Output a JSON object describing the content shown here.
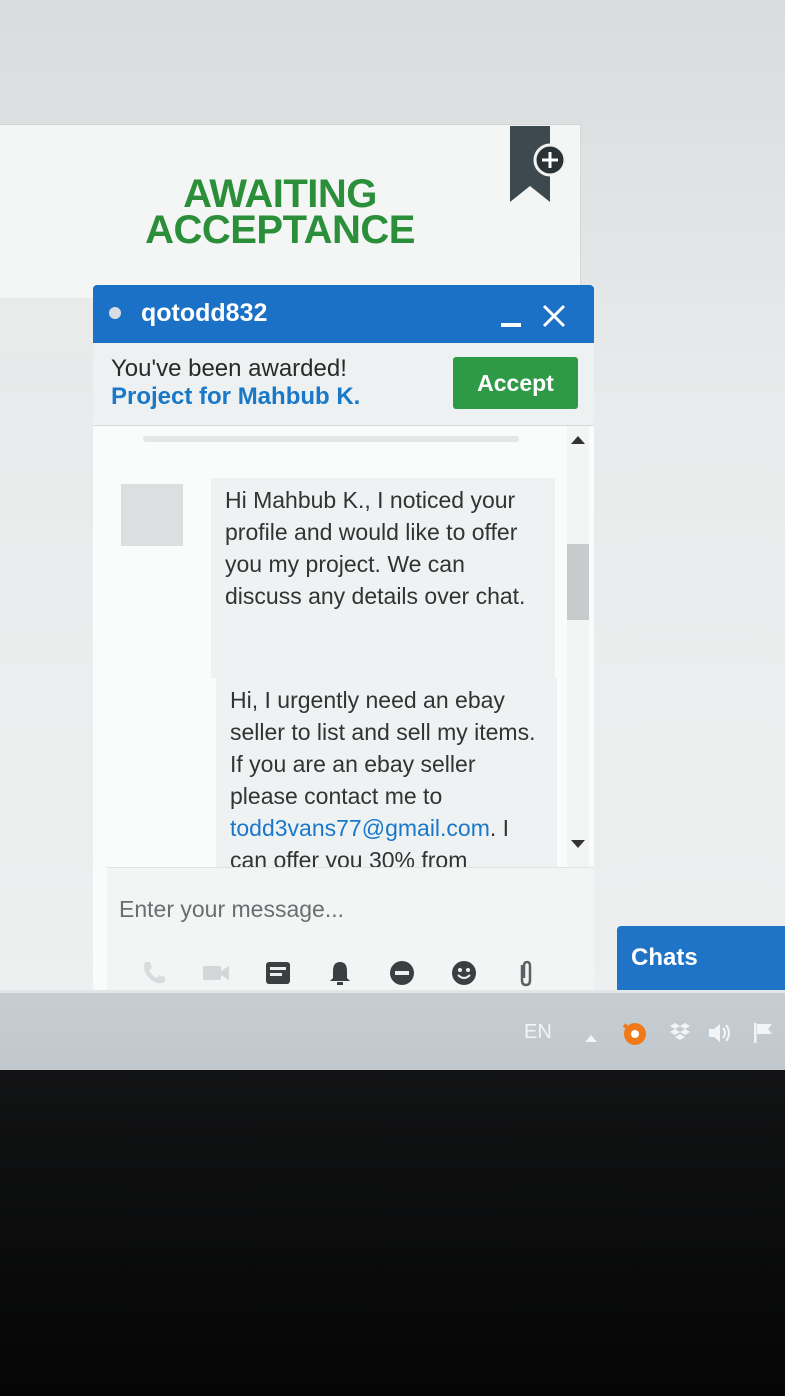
{
  "page": {
    "status_title_line1": "AWAITING",
    "status_title_line2": "ACCEPTANCE"
  },
  "chat": {
    "username": "qotodd832",
    "award_text": "You've been awarded!",
    "award_link": "Project for Mahbub K.",
    "accept_label": "Accept",
    "messages": [
      {
        "text": "Hi Mahbub K., I noticed your profile and would like to offer you my project. We can discuss any details over chat."
      },
      {
        "text_before": "Hi, I urgently need an ebay seller to list and sell my items. If you are an ebay seller please contact me to ",
        "email": "todd3vans77@gmail.com",
        "text_after": ". I can offer you 30% from"
      }
    ],
    "input_placeholder": "Enter your message...",
    "toolbar_icons": [
      "phone-icon",
      "video-icon",
      "card-icon",
      "bell-icon",
      "block-icon",
      "emoji-icon",
      "attachment-icon"
    ]
  },
  "chats_tab": {
    "label": "Chats"
  },
  "taskbar": {
    "language": "EN",
    "tray_icons": [
      "avast-icon",
      "dropbox-icon",
      "volume-icon",
      "flag-icon"
    ]
  },
  "colors": {
    "accent_blue": "#1b71c5",
    "accept_green": "#2f9a46",
    "title_green": "#2b8f3a",
    "link_blue": "#1a78c9"
  }
}
